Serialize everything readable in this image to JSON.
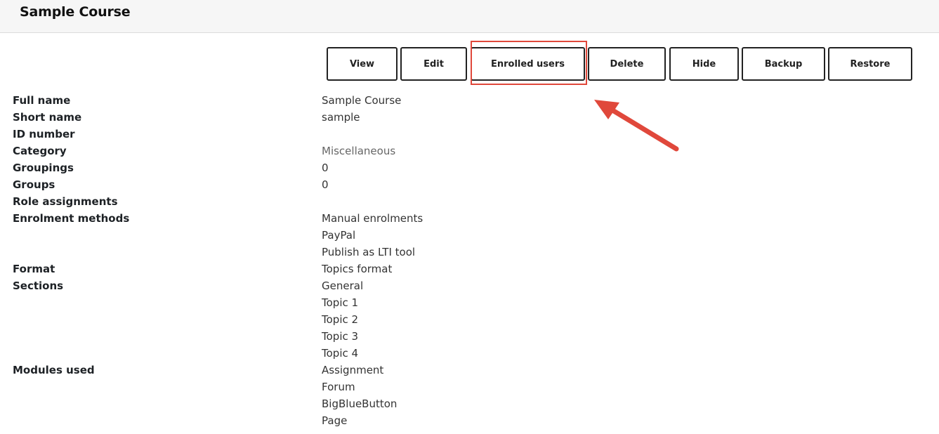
{
  "header": {
    "title": "Sample Course"
  },
  "actions": {
    "view": "View",
    "edit": "Edit",
    "enrolled_users": "Enrolled users",
    "delete": "Delete",
    "hide": "Hide",
    "backup": "Backup",
    "restore": "Restore"
  },
  "annotation": {
    "highlight_color": "#e0483b",
    "arrow_color": "#e0483b"
  },
  "details": {
    "full_name": {
      "label": "Full name",
      "value": "Sample Course"
    },
    "short_name": {
      "label": "Short name",
      "value": "sample"
    },
    "id_number": {
      "label": "ID number",
      "value": ""
    },
    "category": {
      "label": "Category",
      "value": "Miscellaneous"
    },
    "groupings": {
      "label": "Groupings",
      "value": "0"
    },
    "groups": {
      "label": "Groups",
      "value": "0"
    },
    "role_assignments": {
      "label": "Role assignments",
      "value": ""
    },
    "enrolment_methods": {
      "label": "Enrolment methods",
      "values": [
        "Manual enrolments",
        "PayPal",
        "Publish as LTI tool"
      ]
    },
    "format": {
      "label": "Format",
      "value": "Topics format"
    },
    "sections": {
      "label": "Sections",
      "values": [
        "General",
        "Topic 1",
        "Topic 2",
        "Topic 3",
        "Topic 4"
      ]
    },
    "modules_used": {
      "label": "Modules used",
      "values": [
        "Assignment",
        "Forum",
        "BigBlueButton",
        "Page"
      ]
    }
  }
}
